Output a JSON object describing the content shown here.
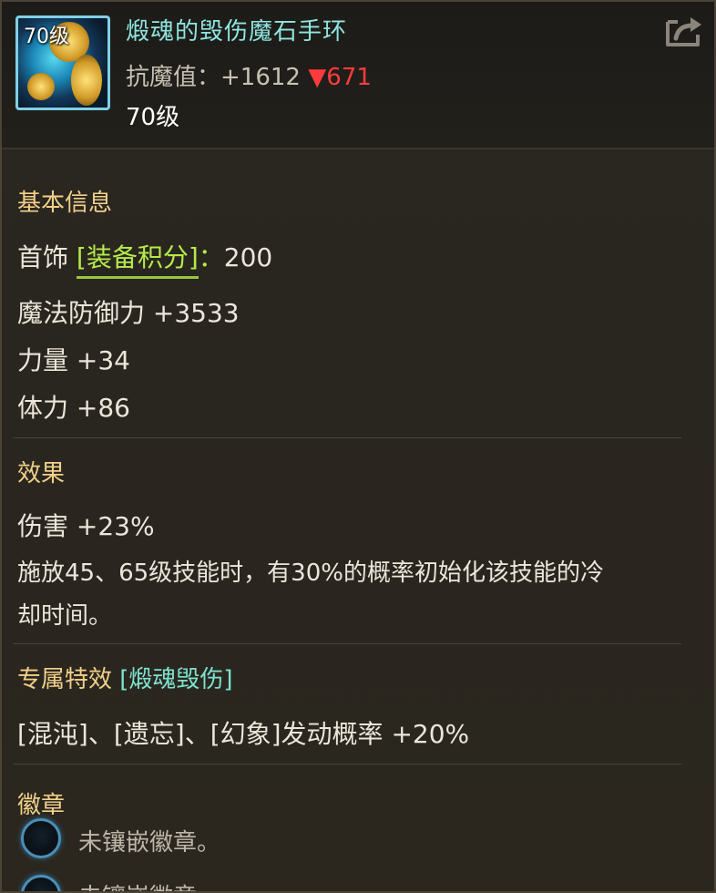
{
  "item": {
    "icon": "bracelet-icon",
    "level_tag": "70级",
    "name": "煅魂的毁伤魔石手环",
    "stat_label": "抗魔值：",
    "stat_value": "+1612",
    "stat_down_arrow": "▼",
    "stat_down_value": "671",
    "level": "70级"
  },
  "basic": {
    "title": "基本信息",
    "slot_label": "首饰",
    "score_label": "[装备积分]",
    "score_sep": "：",
    "score_value": "200",
    "lines": [
      "魔法防御力 +3533",
      "力量 +34",
      "体力 +86"
    ]
  },
  "effect": {
    "title": "效果",
    "lines": [
      "伤害 +23%",
      "施放45、65级技能时，有30%的概率初始化该技能的冷",
      "却时间。"
    ]
  },
  "exclusive": {
    "title": "专属特效",
    "tag": "[煅魂毁伤]",
    "line": "[混沌]、[遗忘]、[幻象]发动概率 +20%"
  },
  "emblem": {
    "title": "徽章",
    "slot1": "未镶嵌徽章。",
    "slot2": "未镶嵌徽章。"
  },
  "colors": {
    "name": "#8ee6e0",
    "section_title": "#f2d08a",
    "down": "#ff3b3b",
    "score_badge": "#b5ea4a",
    "exclusive_tag": "#7de2cf"
  }
}
